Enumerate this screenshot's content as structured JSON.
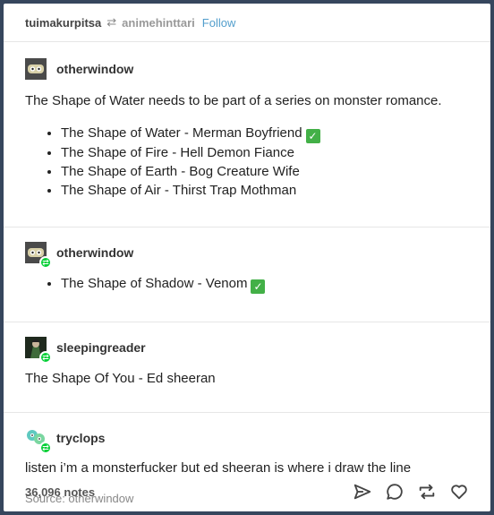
{
  "header": {
    "reblogger": "tuimakurpitsa",
    "reblog_icon": "reblog-icon",
    "source_user": "animehinttari",
    "follow_label": "Follow"
  },
  "posts": [
    {
      "author": "otherwindow",
      "avatar_icon": "robot-avatar-icon",
      "text": "The Shape of Water needs to be part of a series on monster romance.",
      "bullets": [
        "The Shape of Water - Merman Boyfriend",
        "The Shape of Fire - Hell Demon Fiance",
        "The Shape of Earth - Bog Creature Wife",
        "The Shape of Air - Thirst Trap Mothman"
      ]
    },
    {
      "author": "otherwindow",
      "avatar_icon": "robot-avatar-icon",
      "bullets": [
        "The Shape of Shadow - Venom"
      ]
    },
    {
      "author": "sleepingreader",
      "avatar_icon": "character-avatar-icon",
      "text": "The Shape Of You - Ed sheeran"
    },
    {
      "author": "tryclops",
      "avatar_icon": "bubbles-avatar-icon",
      "text": "listen i’m a monsterfucker but ed sheeran is where i draw the line"
    }
  ],
  "source": "Source: otherwindow",
  "footer": {
    "notes": "36,096 notes",
    "icons": [
      "share-icon",
      "reply-icon",
      "reblog-icon",
      "like-icon"
    ]
  },
  "colors": {
    "dashboard_bg": "#36465d",
    "follow_link": "#529ecc",
    "reblog_badge": "#00cf35",
    "check_emoji": "#43b047"
  }
}
